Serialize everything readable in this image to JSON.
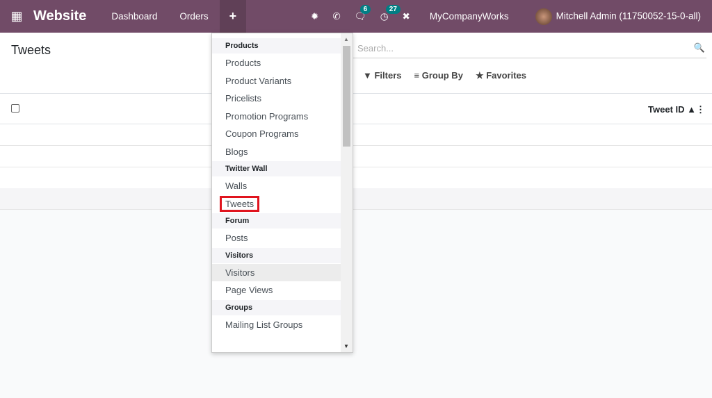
{
  "navbar": {
    "apps_icon": "grid-icon",
    "brand": "Website",
    "menu": [
      "Dashboard",
      "Orders"
    ],
    "plus": "+",
    "icons": [
      "bug-icon",
      "phone-icon",
      "chat-icon",
      "activity-icon",
      "tools-icon"
    ],
    "chat_count": "6",
    "activity_count": "27",
    "company": "MyCompanyWorks",
    "user": "Mitchell Admin (11750052-15-0-all)",
    "accent": "#714B67"
  },
  "page": {
    "title": "Tweets",
    "search_placeholder": "Search...",
    "filters": "Filters",
    "group_by": "Group By",
    "favorites": "Favorites",
    "column": "Tweet ID"
  },
  "dropdown": {
    "sections": [
      {
        "header": "Products",
        "items": [
          "Products",
          "Product Variants",
          "Pricelists",
          "Promotion Programs",
          "Coupon Programs",
          "Blogs"
        ]
      },
      {
        "header": "Twitter Wall",
        "items": [
          "Walls",
          "Tweets"
        ]
      },
      {
        "header": "Forum",
        "items": [
          "Posts"
        ]
      },
      {
        "header": "Visitors",
        "items": [
          "Visitors",
          "Page Views"
        ]
      },
      {
        "header": "Groups",
        "items": [
          "Mailing List Groups"
        ]
      }
    ],
    "highlighted": "Tweets",
    "hovered": "Visitors"
  }
}
